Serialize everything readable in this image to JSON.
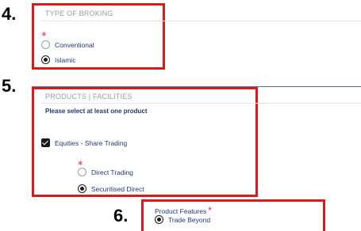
{
  "steps": {
    "s4": "4.",
    "s5": "5.",
    "s6": "6."
  },
  "broking": {
    "title": "TYPE OF BROKING",
    "required_mark": "*",
    "options": [
      {
        "label": "Conventional",
        "selected": false
      },
      {
        "label": "Islamic",
        "selected": true
      }
    ]
  },
  "products": {
    "title": "PRODUCTS | FACILITIES",
    "hint": "Please select at least one product",
    "equities_label": "Equities - Share Trading",
    "equities_checked": true,
    "required_mark": "*",
    "options": [
      {
        "label": "Direct Trading",
        "selected": false
      },
      {
        "label": "Securitised Direct",
        "selected": true
      }
    ]
  },
  "features": {
    "label": "Product Features",
    "required_mark": "*",
    "options": [
      {
        "label": "Trade Beyond",
        "selected": true
      }
    ]
  },
  "colors": {
    "highlight": "#d81b1b",
    "required": "#e0245e",
    "label_text": "#1f3a7a"
  }
}
